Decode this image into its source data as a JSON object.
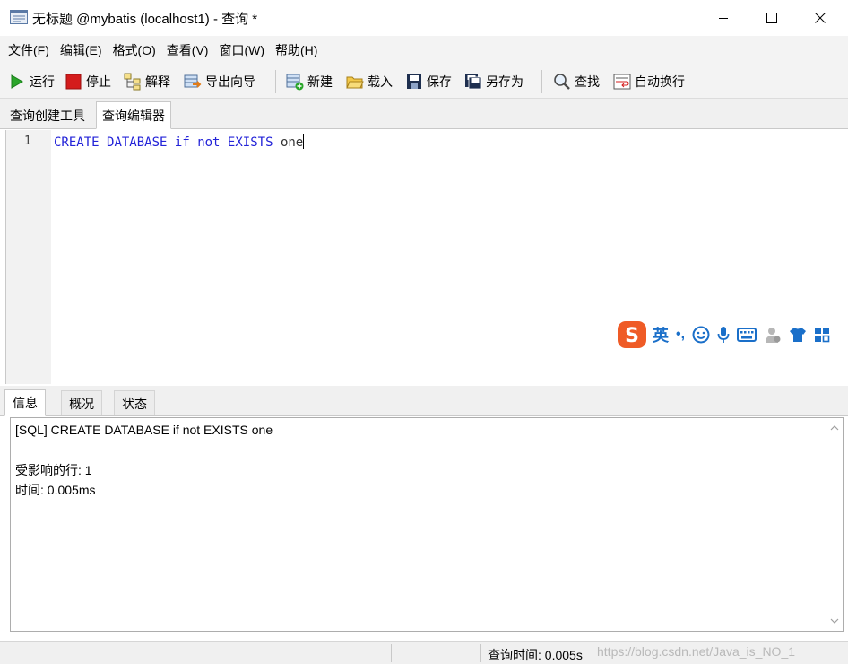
{
  "window": {
    "title": "无标题 @mybatis (localhost1) - 查询 *"
  },
  "menu": {
    "items": [
      "文件(F)",
      "编辑(E)",
      "格式(O)",
      "查看(V)",
      "窗口(W)",
      "帮助(H)"
    ]
  },
  "toolbar": {
    "run": "运行",
    "stop": "停止",
    "explain": "解释",
    "export_wizard": "导出向导",
    "new": "新建",
    "load": "载入",
    "save": "保存",
    "save_as": "另存为",
    "find": "查找",
    "word_wrap": "自动换行"
  },
  "top_tabs": [
    "查询创建工具",
    "查询编辑器"
  ],
  "editor": {
    "line_number": "1",
    "tokens": [
      {
        "text": "CREATE",
        "kind": "kw"
      },
      {
        "text": "DATABASE",
        "kind": "kw"
      },
      {
        "text": "if",
        "kind": "kw"
      },
      {
        "text": "not",
        "kind": "kw"
      },
      {
        "text": "EXISTS",
        "kind": "kw"
      },
      {
        "text": "one",
        "kind": "ident"
      }
    ]
  },
  "ime": {
    "lang": "英",
    "punct": "•,"
  },
  "bottom_tabs": [
    "信息",
    "概况",
    "状态"
  ],
  "output": {
    "sql_line": "[SQL] CREATE DATABASE if not EXISTS one",
    "affected_rows": "受影响的行: 1",
    "time": "时间: 0.005ms"
  },
  "status": {
    "query_time": "查询时间: 0.005s",
    "watermark": "https://blog.csdn.net/Java_is_NO_1"
  },
  "colors": {
    "keyword": "#2323d8",
    "run_green": "#2aa52a",
    "stop_red": "#d41c1c",
    "ime_orange": "#ef5b26",
    "ime_blue": "#1a6fc9"
  }
}
